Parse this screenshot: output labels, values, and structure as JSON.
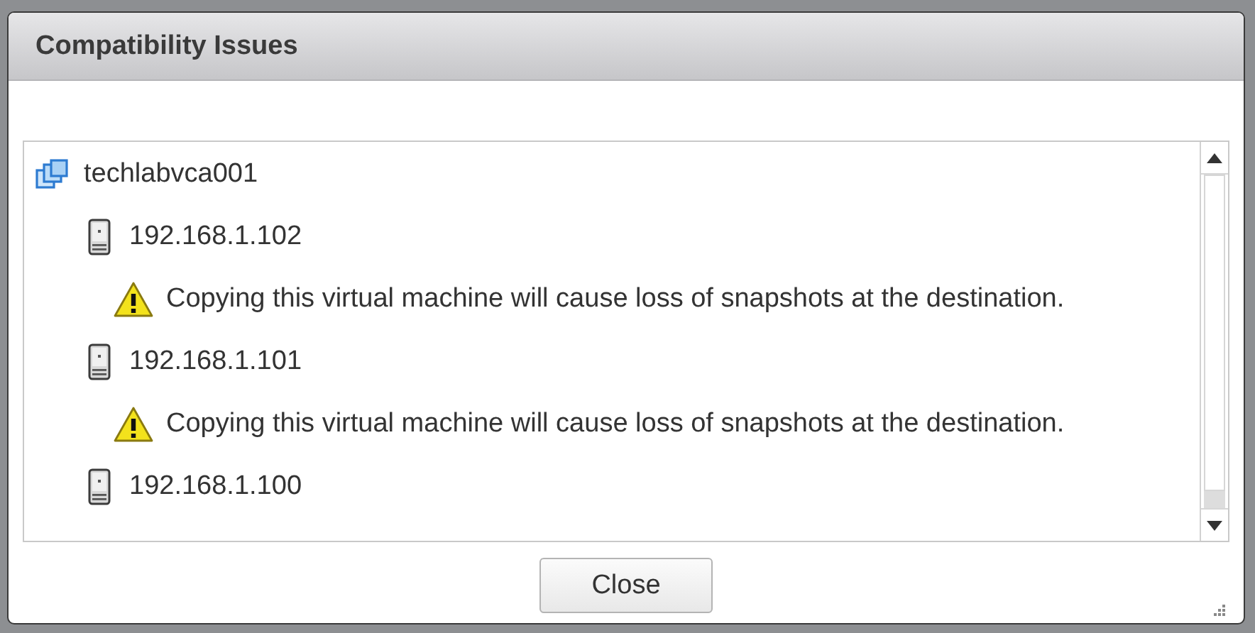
{
  "dialog": {
    "title": "Compatibility Issues",
    "tree": {
      "kind": "vcenter",
      "label": "techlabvca001",
      "children": [
        {
          "kind": "host",
          "label": "192.168.1.102",
          "children": [
            {
              "kind": "warning",
              "label": "Copying this virtual machine will cause loss of snapshots at the destination."
            }
          ]
        },
        {
          "kind": "host",
          "label": "192.168.1.101",
          "children": [
            {
              "kind": "warning",
              "label": "Copying this virtual machine will cause loss of snapshots at the destination."
            }
          ]
        },
        {
          "kind": "host",
          "label": "192.168.1.100"
        }
      ]
    },
    "buttons": [
      "Close"
    ]
  }
}
